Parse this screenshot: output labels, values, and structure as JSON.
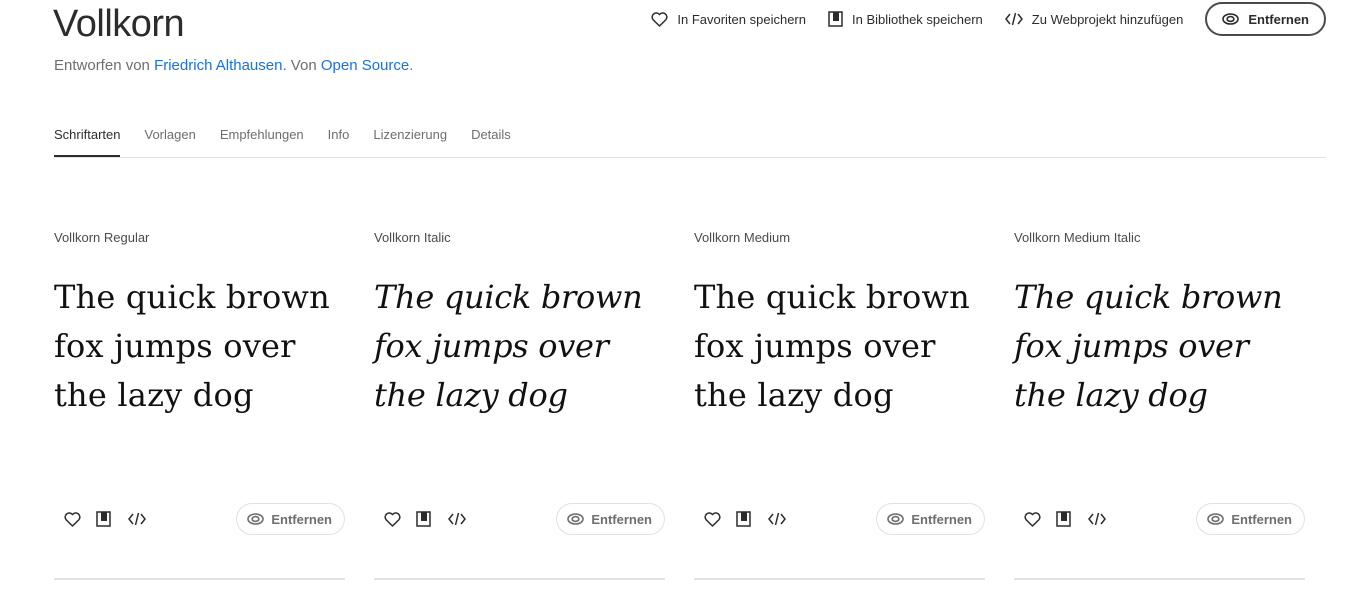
{
  "header": {
    "title": "Vollkorn",
    "byline_prefix": "Entworfen von ",
    "designer": "Friedrich Althausen",
    "byline_mid": ". Von ",
    "foundry": "Open Source",
    "byline_suffix": "."
  },
  "actions": {
    "favorite": "In Favoriten speichern",
    "library": "In Bibliothek speichern",
    "webproject": "Zu Webprojekt hinzufügen",
    "remove": "Entfernen"
  },
  "tabs": [
    "Schriftarten",
    "Vorlagen",
    "Empfehlungen",
    "Info",
    "Lizenzierung",
    "Details"
  ],
  "active_tab": "Schriftarten",
  "cards": [
    {
      "name": "Vollkorn Regular",
      "sample": "The quick brown fox jumps over the lazy dog",
      "style": "regular",
      "remove": "Entfernen"
    },
    {
      "name": "Vollkorn Italic",
      "sample": "The quick brown fox jumps over the lazy dog",
      "style": "italic",
      "remove": "Entfernen"
    },
    {
      "name": "Vollkorn Medium",
      "sample": "The quick brown fox jumps over the lazy dog",
      "style": "medium",
      "remove": "Entfernen"
    },
    {
      "name": "Vollkorn Medium Italic",
      "sample": "The quick brown fox jumps over the lazy dog",
      "style": "medium-italic",
      "remove": "Entfernen"
    }
  ],
  "colors": {
    "link": "#1473e6",
    "text": "#2c2c2c",
    "muted": "#6e6e6e",
    "border": "#e1e1e1"
  },
  "icons": [
    "heart-icon",
    "library-icon",
    "code-icon",
    "creative-cloud-icon"
  ]
}
